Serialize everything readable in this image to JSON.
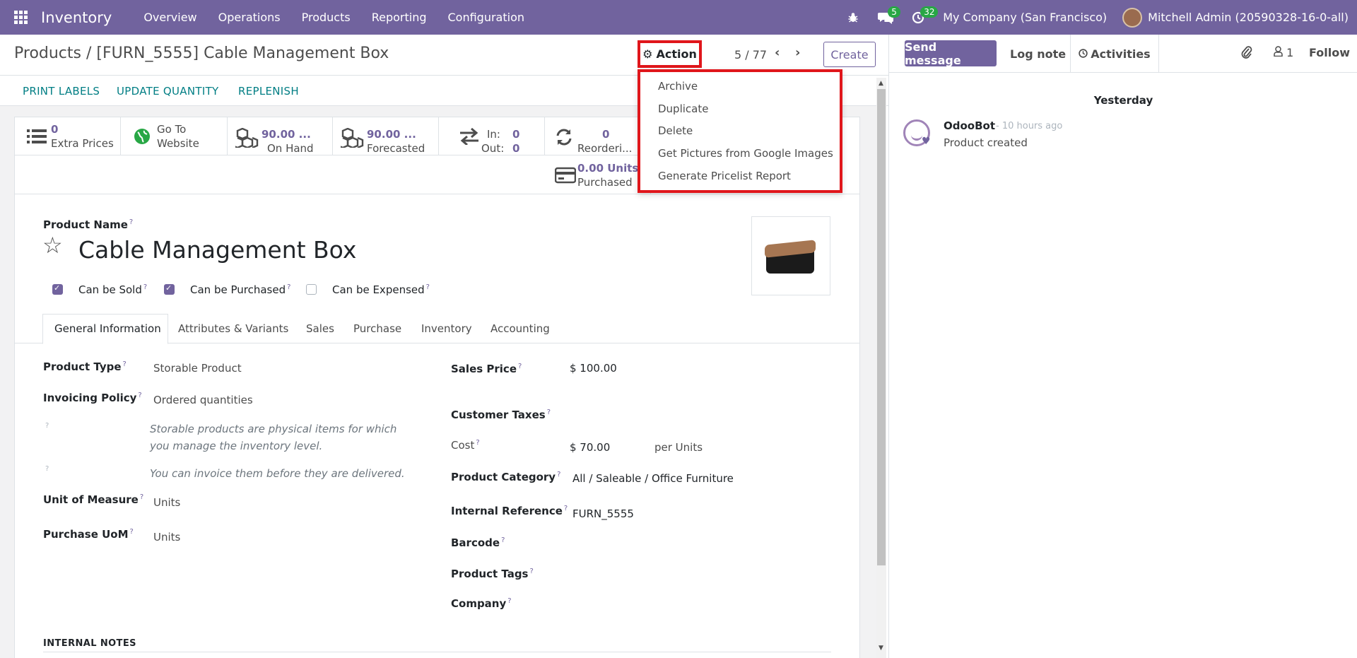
{
  "navbar": {
    "app_name": "Inventory",
    "menu": [
      "Overview",
      "Operations",
      "Products",
      "Reporting",
      "Configuration"
    ],
    "messages_count": "5",
    "activities_count": "32",
    "company": "My Company (San Francisco)",
    "user": "Mitchell Admin (20590328-16-0-all)"
  },
  "control": {
    "breadcrumb_root": "Products",
    "breadcrumb_sep": "/",
    "breadcrumb_current": "[FURN_5555] Cable Management Box",
    "action_label": "Action",
    "pager": "5 / 77",
    "create_label": "Create"
  },
  "status_buttons": [
    "PRINT LABELS",
    "UPDATE QUANTITY",
    "REPLENISH"
  ],
  "action_menu": [
    "Archive",
    "Duplicate",
    "Delete",
    "Get Pictures from Google Images",
    "Generate Pricelist Report"
  ],
  "smart_buttons": {
    "extra_prices": {
      "value": "0",
      "label": "Extra Prices"
    },
    "website": {
      "line1": "Go To",
      "line2": "Website"
    },
    "on_hand": {
      "value": "90.00 ...",
      "label": "On Hand"
    },
    "forecasted": {
      "value": "90.00 ...",
      "label": "Forecasted"
    },
    "in_out": {
      "in_label": "In:",
      "in_value": "0",
      "out_label": "Out:",
      "out_value": "0"
    },
    "reordering": {
      "value": "0",
      "label": "Reorderi..."
    },
    "purchased": {
      "value": "0.00 Units",
      "label": "Purchased"
    }
  },
  "product": {
    "name_label": "Product Name",
    "name": "Cable Management Box",
    "can_be_sold": "Can be Sold",
    "can_be_purchased": "Can be Purchased",
    "can_be_expensed": "Can be Expensed"
  },
  "tabs": [
    "General Information",
    "Attributes & Variants",
    "Sales",
    "Purchase",
    "Inventory",
    "Accounting"
  ],
  "general": {
    "product_type_label": "Product Type",
    "product_type": "Storable Product",
    "invoicing_policy_label": "Invoicing Policy",
    "invoicing_policy": "Ordered quantities",
    "hint1": "Storable products are physical items for which you manage the inventory level.",
    "hint2": "You can invoice them before they are delivered.",
    "uom_label": "Unit of Measure",
    "uom": "Units",
    "purchase_uom_label": "Purchase UoM",
    "purchase_uom": "Units",
    "sales_price_label": "Sales Price",
    "sales_price": "$ 100.00",
    "customer_taxes_label": "Customer Taxes",
    "cost_label": "Cost",
    "cost": "$ 70.00",
    "cost_unit": "per Units",
    "category_label": "Product Category",
    "category": "All / Saleable / Office Furniture",
    "internal_ref_label": "Internal Reference",
    "internal_ref": "FURN_5555",
    "barcode_label": "Barcode",
    "tags_label": "Product Tags",
    "company_label": "Company",
    "internal_notes": "INTERNAL NOTES"
  },
  "chatter": {
    "send_message": "Send message",
    "log_note": "Log note",
    "activities": "Activities",
    "followers_count": "1",
    "follow": "Follow",
    "day": "Yesterday",
    "author": "OdooBot",
    "time": "- 10 hours ago",
    "body": "Product created"
  },
  "colors": {
    "brand": "#71639e",
    "highlight": "#e0161b",
    "badge": "#28a745"
  }
}
